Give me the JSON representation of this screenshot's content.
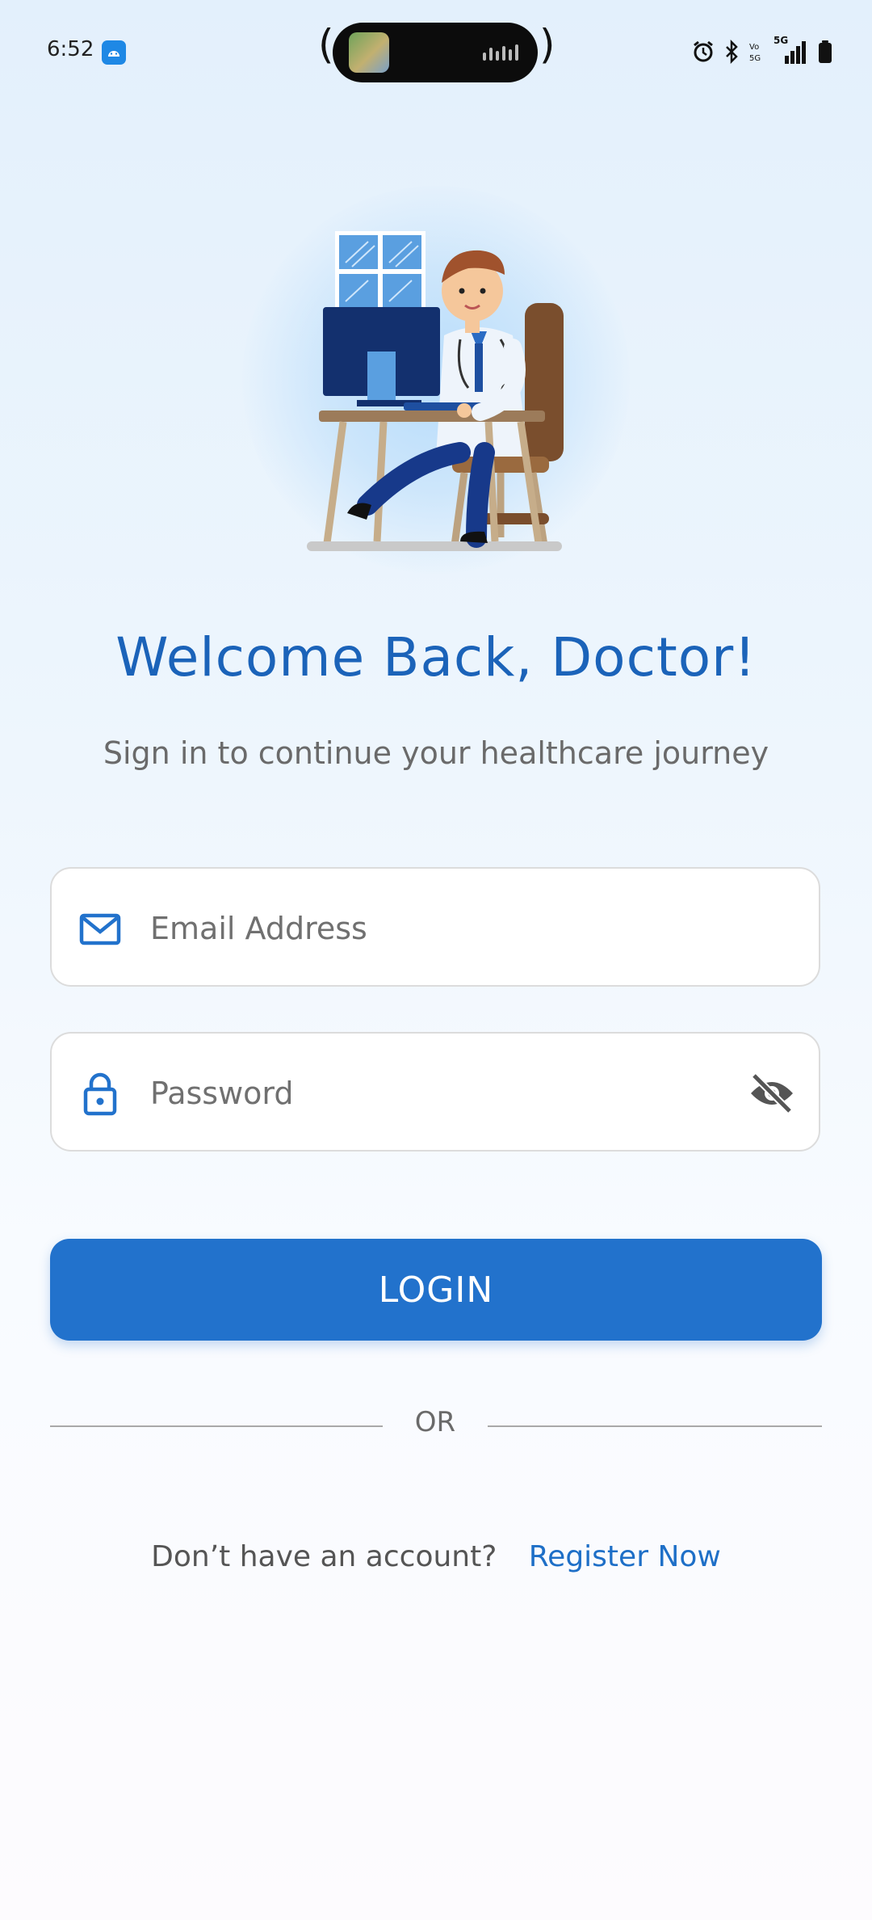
{
  "status_bar": {
    "time": "6:52",
    "network_label": "5G",
    "volte_label": "Vo\n5G"
  },
  "header": {
    "title": "Welcome Back, Doctor!",
    "subtitle": "Sign in to continue your healthcare journey"
  },
  "form": {
    "email": {
      "placeholder": "Email Address",
      "value": ""
    },
    "password": {
      "placeholder": "Password",
      "value": ""
    },
    "login_label": "LOGIN"
  },
  "divider": {
    "label": "OR"
  },
  "register": {
    "prompt": "Don’t have an account?",
    "link_label": "Register Now"
  },
  "colors": {
    "primary": "#2272cc",
    "title": "#1b63b9",
    "link": "#1e6fc7"
  }
}
